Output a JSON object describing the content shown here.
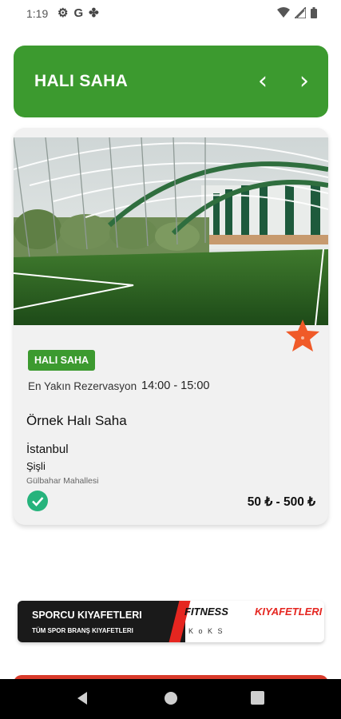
{
  "status_bar": {
    "time": "1:19",
    "left_icons": [
      "settings-icon",
      "google-icon",
      "pinwheel-icon"
    ],
    "right_icons": [
      "wifi-icon",
      "signal-icon",
      "battery-icon"
    ]
  },
  "header": {
    "title": "HALI SAHA",
    "prev_label": "‹",
    "next_label": "›",
    "color": "#3c9a2f"
  },
  "card": {
    "photo_icon": "indoor-football-field-photo",
    "badge": "HALI SAHA",
    "reservation_label": "En Yakın Rezervasyon",
    "reservation_time": "14:00 - 15:00",
    "name": "Örnek Halı Saha",
    "city": "İstanbul",
    "district": "Şişli",
    "neighborhood": "Gülbahar Mahallesi",
    "price": "50 ₺ - 500 ₺",
    "favorite_color": "#f05a28",
    "verified_color": "#26b37c"
  },
  "banner": {
    "title": "SPORCU KIYAFETLERI",
    "subtitle": "TÜM SPOR BRANŞ KIYAFETLERI",
    "right_word_1": "FITNESS",
    "right_word_2": "KIYAFETLERI",
    "logos_text": "K  o  K  S"
  },
  "nav_bar": {
    "icons": [
      "back-icon",
      "home-icon",
      "recent-apps-icon"
    ]
  }
}
